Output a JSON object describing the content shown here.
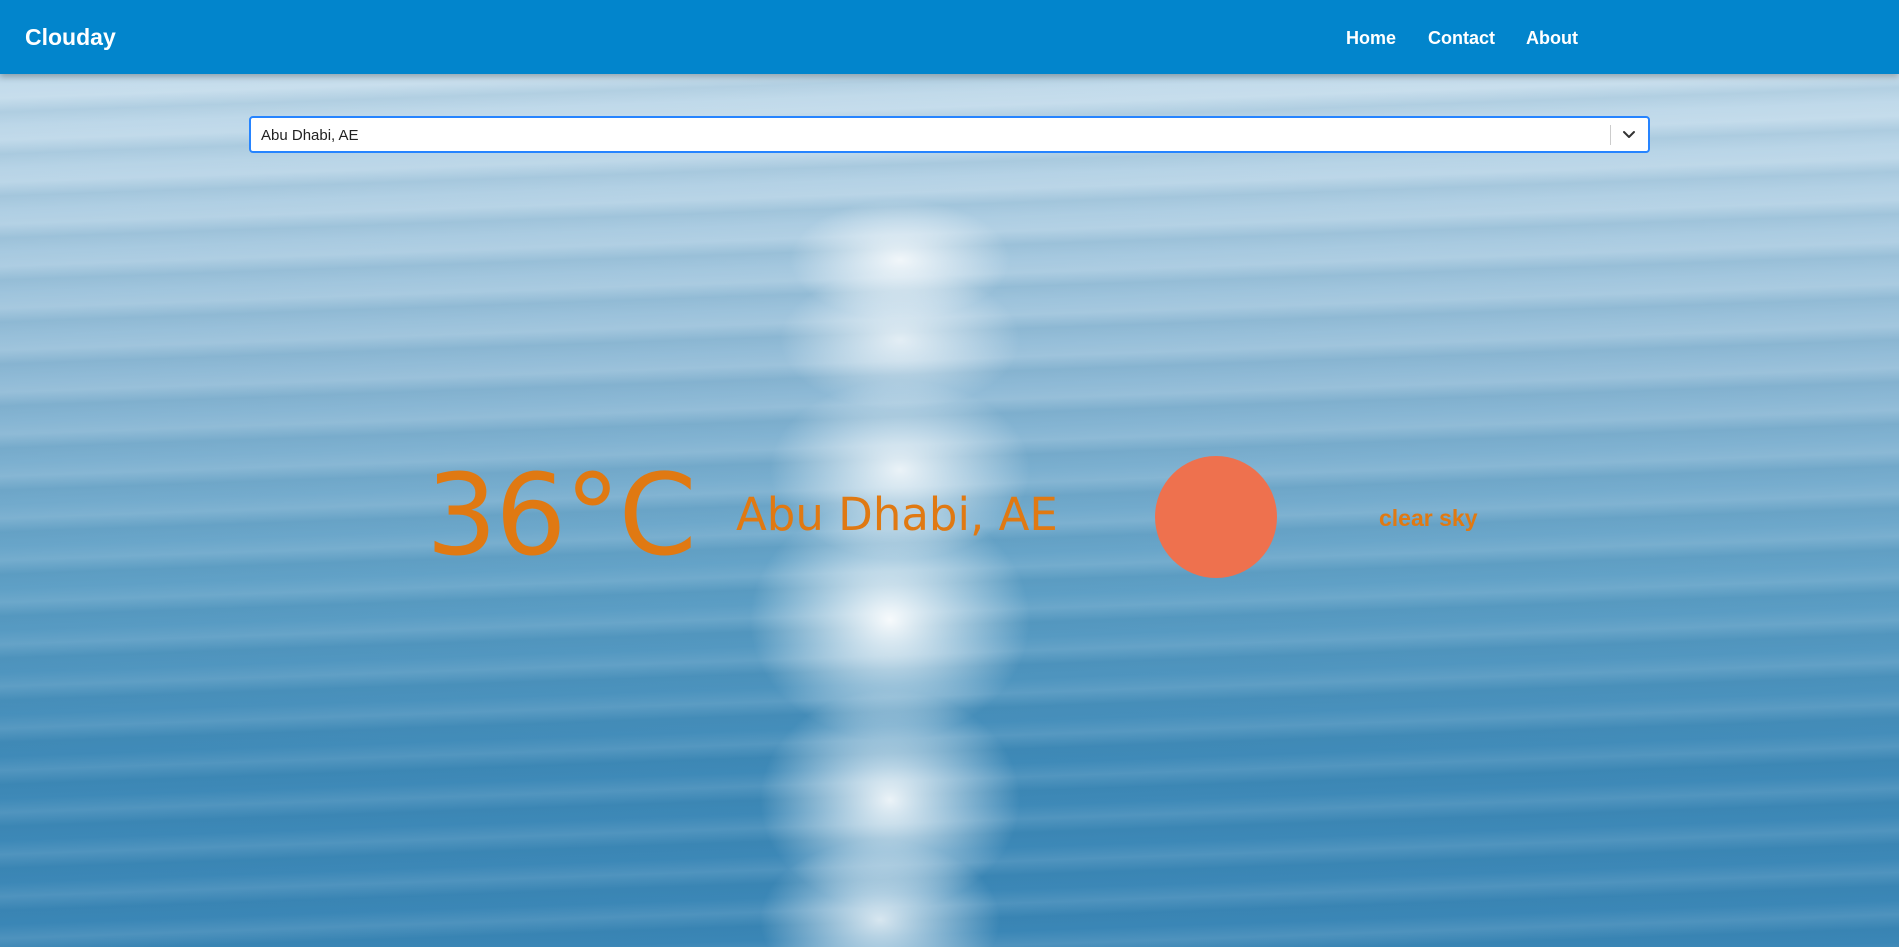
{
  "navbar": {
    "brand": "Clouday",
    "links": [
      {
        "label": "Home"
      },
      {
        "label": "Contact"
      },
      {
        "label": "About"
      }
    ],
    "color": "#0285cc"
  },
  "city_select": {
    "value": "Abu Dhabi, AE",
    "icon": "chevron-down-icon"
  },
  "weather": {
    "temperature": "36°C",
    "city": "Abu Dhabi, AE",
    "icon": "sun-icon",
    "description": "clear sky",
    "accent_color": "#e07912",
    "sun_color": "#ee714e"
  }
}
